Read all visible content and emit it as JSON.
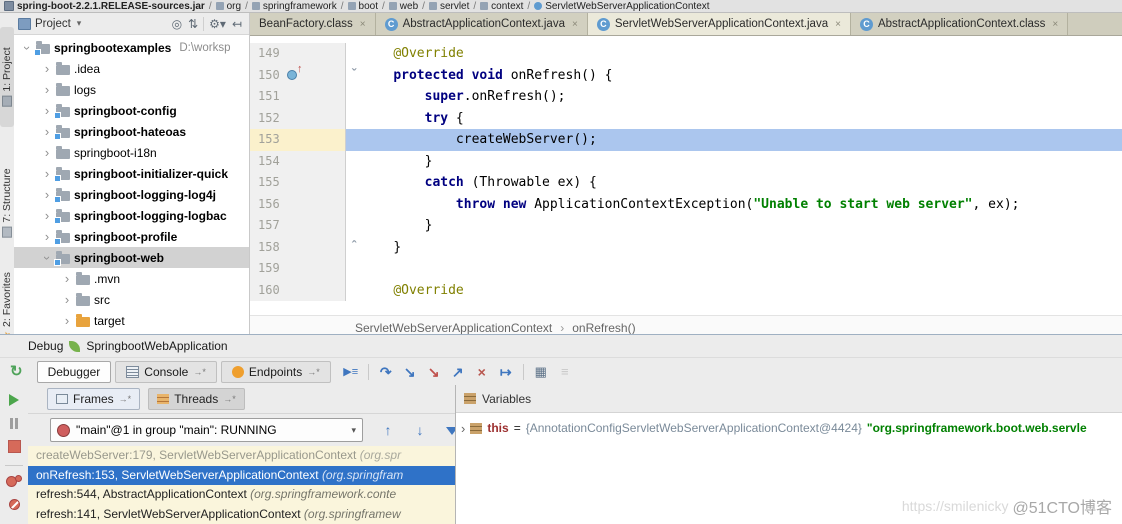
{
  "colors": {
    "execution_line": "#abc6ee",
    "gutter_current_line": "#fbf1cc",
    "frame_list_background": "#faf5dc",
    "selected_frame": "#2f72c8",
    "keyword": "#000080",
    "annotation": "#808000",
    "string": "#008000",
    "tree_selection": "#d2d2d2"
  },
  "top_breadcrumb": {
    "items": [
      {
        "label": "spring-boot-2.2.1.RELEASE-sources.jar",
        "bold": true,
        "icon": "jar-icon"
      },
      {
        "label": "org",
        "icon": "package-icon"
      },
      {
        "label": "springframework",
        "icon": "package-icon"
      },
      {
        "label": "boot",
        "icon": "package-icon"
      },
      {
        "label": "web",
        "icon": "package-icon"
      },
      {
        "label": "servlet",
        "icon": "package-icon"
      },
      {
        "label": "context",
        "icon": "package-icon"
      },
      {
        "label": "ServletWebServerApplicationContext",
        "icon": "class-icon-small"
      }
    ]
  },
  "tool_strip": {
    "items": [
      {
        "label": "1: Project",
        "icon": "project-icon",
        "active": true
      },
      {
        "label": "7: Structure",
        "icon": "structure-icon"
      },
      {
        "label": "2: Favorites",
        "icon": "star-icon"
      }
    ]
  },
  "project_panel": {
    "title": "Project",
    "dropdown_caret": "▾",
    "header_icons": [
      "locate-icon",
      "collapse-all-icon",
      "settings-gear-icon",
      "hide-panel-icon"
    ],
    "tree": [
      {
        "label": "springbootexamples",
        "path_suffix": "D:\\worksp",
        "bold": true,
        "expanded": true,
        "level": 0,
        "icon": "module-folder-icon"
      },
      {
        "label": ".idea",
        "level": 1,
        "icon": "folder-icon"
      },
      {
        "label": "logs",
        "level": 1,
        "icon": "folder-icon"
      },
      {
        "label": "springboot-config",
        "bold": true,
        "level": 1,
        "icon": "module-folder-icon"
      },
      {
        "label": "springboot-hateoas",
        "bold": true,
        "level": 1,
        "icon": "module-folder-icon"
      },
      {
        "label": "springboot-i18n",
        "level": 1,
        "icon": "folder-icon"
      },
      {
        "label": "springboot-initializer-quick",
        "bold": true,
        "level": 1,
        "icon": "module-folder-icon"
      },
      {
        "label": "springboot-logging-log4j",
        "bold": true,
        "level": 1,
        "icon": "module-folder-icon"
      },
      {
        "label": "springboot-logging-logbac",
        "bold": true,
        "level": 1,
        "icon": "module-folder-icon"
      },
      {
        "label": "springboot-profile",
        "bold": true,
        "level": 1,
        "icon": "module-folder-icon"
      },
      {
        "label": "springboot-web",
        "bold": true,
        "expanded": true,
        "selected": true,
        "level": 1,
        "icon": "module-folder-icon"
      },
      {
        "label": ".mvn",
        "level": 2,
        "icon": "folder-icon"
      },
      {
        "label": "src",
        "level": 2,
        "icon": "folder-icon"
      },
      {
        "label": "target",
        "level": 2,
        "icon": "target-folder-icon"
      }
    ]
  },
  "editor": {
    "tabs": [
      {
        "label": "BeanFactory.class",
        "icon": false,
        "active": false
      },
      {
        "label": "AbstractApplicationContext.java",
        "icon": true,
        "active": false
      },
      {
        "label": "ServletWebServerApplicationContext.java",
        "icon": true,
        "active": true
      },
      {
        "label": "AbstractApplicationContext.class",
        "icon": true,
        "active": false
      }
    ],
    "breadcrumb": {
      "class_name": "ServletWebServerApplicationContext",
      "separator": "›",
      "method_name": "onRefresh()"
    },
    "code": {
      "lines": [
        {
          "no": 149,
          "indent": 4,
          "segments": [
            {
              "c": "ann",
              "t": "@Override"
            }
          ]
        },
        {
          "no": 150,
          "indent": 4,
          "gutter_icon": "override-method-icon",
          "fold": "down",
          "segments": [
            {
              "c": "kw",
              "t": "protected void"
            },
            {
              "c": "pl",
              "t": " onRefresh() {"
            }
          ]
        },
        {
          "no": 151,
          "indent": 8,
          "segments": [
            {
              "c": "kw",
              "t": "super"
            },
            {
              "c": "pl",
              "t": ".onRefresh();"
            }
          ]
        },
        {
          "no": 152,
          "indent": 8,
          "segments": [
            {
              "c": "kw",
              "t": "try"
            },
            {
              "c": "pl",
              "t": " {"
            }
          ]
        },
        {
          "no": 153,
          "indent": 12,
          "highlight": true,
          "segments": [
            {
              "c": "pl",
              "t": "createWebServer();"
            }
          ]
        },
        {
          "no": 154,
          "indent": 8,
          "segments": [
            {
              "c": "pl",
              "t": "}"
            }
          ]
        },
        {
          "no": 155,
          "indent": 8,
          "segments": [
            {
              "c": "kw",
              "t": "catch"
            },
            {
              "c": "pl",
              "t": " (Throwable ex) {"
            }
          ]
        },
        {
          "no": 156,
          "indent": 12,
          "segments": [
            {
              "c": "kw",
              "t": "throw new"
            },
            {
              "c": "pl",
              "t": " ApplicationContextException("
            },
            {
              "c": "str",
              "t": "\"Unable to start web server\""
            },
            {
              "c": "pl",
              "t": ", ex);"
            }
          ]
        },
        {
          "no": 157,
          "indent": 8,
          "segments": [
            {
              "c": "pl",
              "t": "}"
            }
          ]
        },
        {
          "no": 158,
          "indent": 4,
          "fold": "up",
          "segments": [
            {
              "c": "pl",
              "t": "}"
            }
          ]
        },
        {
          "no": 159,
          "indent": 0,
          "segments": []
        },
        {
          "no": 160,
          "indent": 4,
          "segments": [
            {
              "c": "ann",
              "t": "@Override"
            }
          ]
        }
      ]
    }
  },
  "debug": {
    "title": "Debug",
    "app_name": "SpringbootWebApplication",
    "toolbar": {
      "left_icon": "rerun-icon",
      "tabs": [
        {
          "label": "Debugger",
          "active": true
        },
        {
          "label": "Console",
          "icon": "console-icon",
          "suffix": "→*"
        },
        {
          "label": "Endpoints",
          "icon": "endpoints-icon",
          "suffix": "→*"
        }
      ],
      "action_icons": [
        "show-execution-point-icon",
        "sep",
        "step-over-icon",
        "step-into-icon",
        "force-step-into-icon",
        "step-out-icon",
        "drop-frame-icon",
        "run-to-cursor-icon",
        "sep",
        "evaluate-expression-icon",
        "trace-stream-icon"
      ]
    },
    "side_icons": [
      "resume-icon",
      "pause-icon",
      "stop-icon",
      "sep",
      "view-breakpoints-icon",
      "mute-breakpoints-icon"
    ],
    "frames": {
      "tabs": [
        {
          "label": "Frames",
          "suffix": "→*",
          "icon": "frames-icon",
          "active": true
        },
        {
          "label": "Threads",
          "suffix": "→*",
          "icon": "threads-icon"
        }
      ],
      "thread_selector": {
        "value": "\"main\"@1 in group \"main\": RUNNING",
        "icon": "thread-icon",
        "caret": "▾"
      },
      "nav_icons": [
        "frame-up-icon",
        "frame-down-icon",
        "filter-icon"
      ],
      "stack": [
        {
          "text": "createWebServer:179, ServletWebServerApplicationContext ",
          "package": "(org.spr",
          "muted": true
        },
        {
          "text": "onRefresh:153, ServletWebServerApplicationContext ",
          "package": "(org.springfram",
          "selected": true
        },
        {
          "text": "refresh:544, AbstractApplicationContext ",
          "package": "(org.springframework.conte"
        },
        {
          "text": "refresh:141, ServletWebServerApplicationContext ",
          "package": "(org.springframew"
        }
      ]
    },
    "variables": {
      "title": "Variables",
      "rows": [
        {
          "name": "this",
          "separator": " = ",
          "reference": "{AnnotationConfigServletWebServerApplicationContext@4424}",
          "value": "\"org.springframework.boot.web.servle"
        }
      ]
    }
  },
  "watermark": {
    "line1": "https://smilenicky",
    "line2": "@51CTO博客"
  }
}
